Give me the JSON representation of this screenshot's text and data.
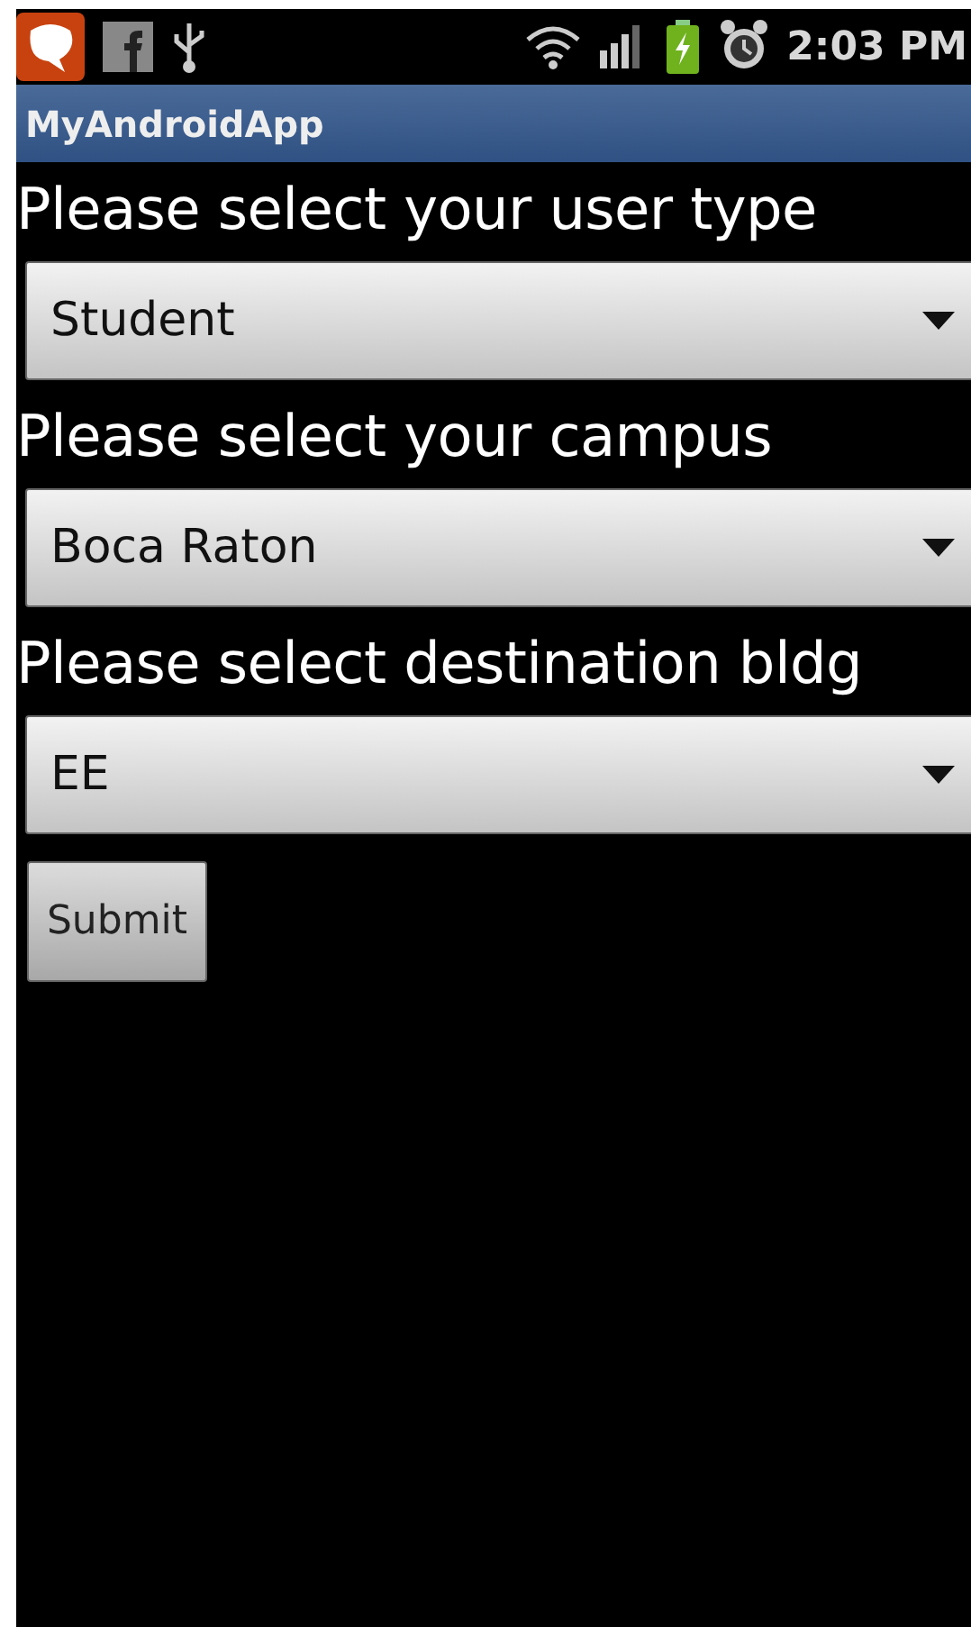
{
  "status_bar": {
    "time": "2:03 PM"
  },
  "title_bar": {
    "title": "MyAndroidApp"
  },
  "form": [
    {
      "label": "Please select your user type",
      "value": "Student"
    },
    {
      "label": "Please select your campus",
      "value": "Boca Raton"
    },
    {
      "label": "Please select destination bldg",
      "value": "EE"
    }
  ],
  "submit_button": {
    "label": "Submit"
  }
}
